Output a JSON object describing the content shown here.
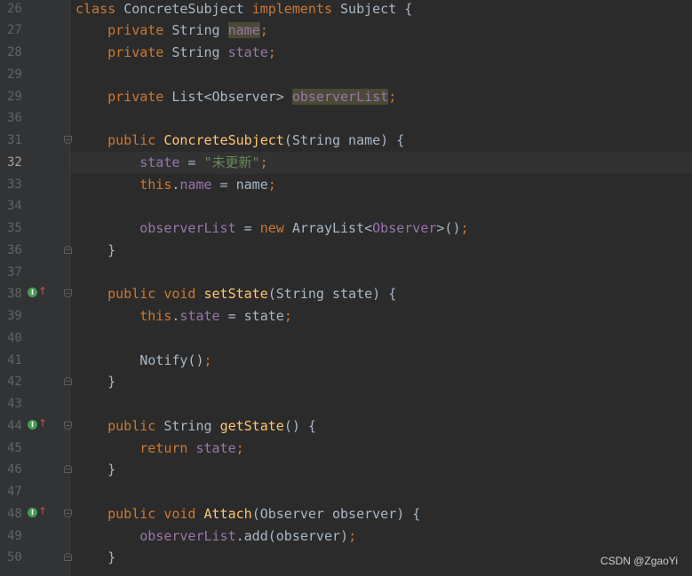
{
  "colors": {
    "background": "#2b2b2b",
    "gutter": "#313335",
    "keyword": "#cc7832",
    "field": "#9876aa",
    "method": "#ffc66d",
    "string": "#6a8759",
    "text": "#a9b7c6"
  },
  "current_line_index": 7,
  "lines": [
    {
      "n": "26",
      "tokens": [
        [
          "class ",
          "kw"
        ],
        [
          "ConcreteSubject ",
          "pl"
        ],
        [
          "implements ",
          "kw"
        ],
        [
          "Subject {",
          "pl"
        ]
      ]
    },
    {
      "n": "27",
      "tokens": [
        [
          "    ",
          "pl"
        ],
        [
          "private ",
          "kw"
        ],
        [
          "String ",
          "pl"
        ],
        [
          "name",
          "fld hl"
        ],
        [
          ";",
          "kw"
        ]
      ]
    },
    {
      "n": "28",
      "tokens": [
        [
          "    ",
          "pl"
        ],
        [
          "private ",
          "kw"
        ],
        [
          "String ",
          "pl"
        ],
        [
          "state",
          "fld"
        ],
        [
          ";",
          "kw"
        ]
      ]
    },
    {
      "n": "29",
      "tokens": []
    },
    {
      "n": "29",
      "tokens": [
        [
          "    ",
          "pl"
        ],
        [
          "private ",
          "kw"
        ],
        [
          "List<Observer> ",
          "pl"
        ],
        [
          "observerList",
          "fld hl"
        ],
        [
          ";",
          "kw"
        ]
      ]
    },
    {
      "n": "36",
      "tokens": []
    },
    {
      "n": "31",
      "fold": "start",
      "tokens": [
        [
          "    ",
          "pl"
        ],
        [
          "public ",
          "kw"
        ],
        [
          "ConcreteSubject",
          "fn"
        ],
        [
          "(String name) {",
          "pl"
        ]
      ]
    },
    {
      "n": "32",
      "tokens": [
        [
          "        ",
          "pl"
        ],
        [
          "state",
          "fld"
        ],
        [
          " = ",
          "pl"
        ],
        [
          "\"未更新\"",
          "str"
        ],
        [
          ";",
          "kw"
        ]
      ]
    },
    {
      "n": "33",
      "tokens": [
        [
          "        ",
          "pl"
        ],
        [
          "this",
          "kw"
        ],
        [
          ".",
          "pl"
        ],
        [
          "name",
          "fld"
        ],
        [
          " = name",
          "pl"
        ],
        [
          ";",
          "kw"
        ]
      ]
    },
    {
      "n": "34",
      "tokens": []
    },
    {
      "n": "35",
      "tokens": [
        [
          "        ",
          "pl"
        ],
        [
          "observerList",
          "fld"
        ],
        [
          " = ",
          "pl"
        ],
        [
          "new ",
          "kw"
        ],
        [
          "ArrayList<",
          "pl"
        ],
        [
          "Observer",
          "fld"
        ],
        [
          ">()",
          "pl"
        ],
        [
          ";",
          "kw"
        ]
      ]
    },
    {
      "n": "36",
      "fold": "end",
      "tokens": [
        [
          "    }",
          "pl"
        ]
      ]
    },
    {
      "n": "37",
      "tokens": []
    },
    {
      "n": "38",
      "override": true,
      "fold": "start",
      "tokens": [
        [
          "    ",
          "pl"
        ],
        [
          "public ",
          "kw"
        ],
        [
          "void ",
          "kw"
        ],
        [
          "setState",
          "fn"
        ],
        [
          "(String state) {",
          "pl"
        ]
      ]
    },
    {
      "n": "39",
      "tokens": [
        [
          "        ",
          "pl"
        ],
        [
          "this",
          "kw"
        ],
        [
          ".",
          "pl"
        ],
        [
          "state",
          "fld"
        ],
        [
          " = state",
          "pl"
        ],
        [
          ";",
          "kw"
        ]
      ]
    },
    {
      "n": "40",
      "tokens": []
    },
    {
      "n": "41",
      "tokens": [
        [
          "        Notify()",
          "pl"
        ],
        [
          ";",
          "kw"
        ]
      ]
    },
    {
      "n": "42",
      "fold": "end",
      "tokens": [
        [
          "    }",
          "pl"
        ]
      ]
    },
    {
      "n": "43",
      "tokens": []
    },
    {
      "n": "44",
      "override": true,
      "fold": "start",
      "tokens": [
        [
          "    ",
          "pl"
        ],
        [
          "public ",
          "kw"
        ],
        [
          "String ",
          "pl"
        ],
        [
          "getState",
          "fn"
        ],
        [
          "() {",
          "pl"
        ]
      ]
    },
    {
      "n": "45",
      "tokens": [
        [
          "        ",
          "pl"
        ],
        [
          "return ",
          "kw"
        ],
        [
          "state",
          "fld"
        ],
        [
          ";",
          "kw"
        ]
      ]
    },
    {
      "n": "46",
      "fold": "end",
      "tokens": [
        [
          "    }",
          "pl"
        ]
      ]
    },
    {
      "n": "47",
      "tokens": []
    },
    {
      "n": "48",
      "override": true,
      "fold": "start",
      "tokens": [
        [
          "    ",
          "pl"
        ],
        [
          "public ",
          "kw"
        ],
        [
          "void ",
          "kw"
        ],
        [
          "Attach",
          "fn"
        ],
        [
          "(Observer observer) {",
          "pl"
        ]
      ]
    },
    {
      "n": "49",
      "tokens": [
        [
          "        ",
          "pl"
        ],
        [
          "observerList",
          "fld"
        ],
        [
          ".add(observer)",
          "pl"
        ],
        [
          ";",
          "kw"
        ]
      ]
    },
    {
      "n": "50",
      "fold": "end",
      "tokens": [
        [
          "    }",
          "pl"
        ]
      ]
    }
  ],
  "watermark": "CSDN @ZgaoYi"
}
